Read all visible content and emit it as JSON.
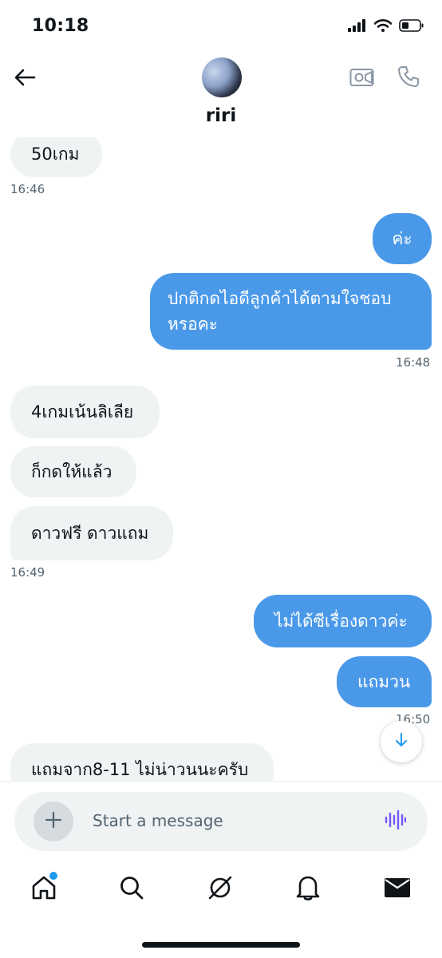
{
  "status_bar": {
    "time": "10:18"
  },
  "header": {
    "contact_name": "riri"
  },
  "messages": [
    {
      "dir": "in",
      "text": "50เกม"
    },
    {
      "dir": "out",
      "text": "ค่ะ"
    },
    {
      "dir": "out",
      "text": "ปกติกดไอดีลูกค้าได้ตามใจชอบ"
    },
    {
      "dir": "out",
      "text": "หรอคะ"
    },
    {
      "dir": "in",
      "text": "4เกมเน้นลิเลีย"
    },
    {
      "dir": "in",
      "text": "ก็กดให้แล้ว"
    },
    {
      "dir": "in",
      "text": "ดาวฟรี ดาวแถม"
    },
    {
      "dir": "out",
      "text": "ไม่ได้ซีเรื่องดาวค่ะ"
    },
    {
      "dir": "out",
      "text": "แถมวน"
    },
    {
      "dir": "in",
      "text": "แถมจาก8-11 ไม่น่าวนนะครับ"
    }
  ],
  "timestamps": [
    "16:46",
    "16:48",
    "16:49",
    "16:50"
  ],
  "composer": {
    "placeholder": "Start a message"
  },
  "colors": {
    "outgoing_bubble": "#4a99e9",
    "incoming_bubble": "#eff3f4",
    "accent": "#1d9bf0",
    "voice_icon": "#7856ff"
  },
  "icons": {
    "status": [
      "signal-icon",
      "wifi-icon",
      "battery-icon"
    ],
    "header": [
      "back-arrow-icon",
      "video-call-icon",
      "phone-icon"
    ],
    "composer": [
      "plus-icon",
      "voice-wave-icon"
    ],
    "tabs": [
      "home-icon",
      "search-icon",
      "grok-icon",
      "bell-icon",
      "mail-icon"
    ]
  }
}
